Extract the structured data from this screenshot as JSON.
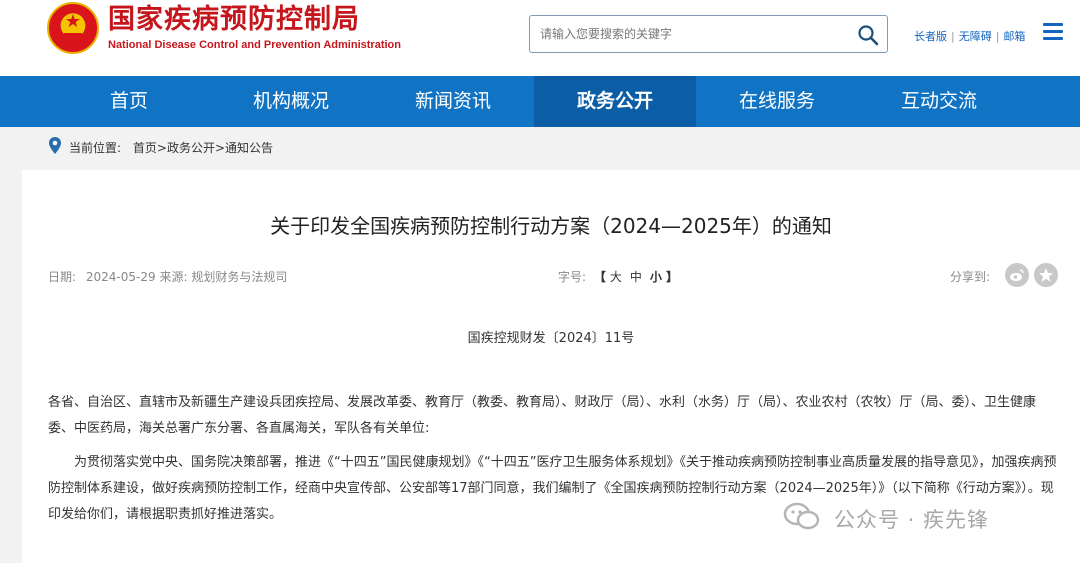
{
  "header": {
    "logo_cn": "国家疾病预防控制局",
    "logo_en": "National Disease Control and Prevention Administration",
    "search_placeholder": "请输入您要搜索的关键字",
    "links": [
      "长者版",
      "无障碍",
      "邮箱"
    ]
  },
  "nav": {
    "items": [
      {
        "label": "首页"
      },
      {
        "label": "机构概况"
      },
      {
        "label": "新闻资讯"
      },
      {
        "label": "政务公开"
      },
      {
        "label": "在线服务"
      },
      {
        "label": "互动交流"
      }
    ],
    "active": "政务公开"
  },
  "breadcrumb": {
    "prefix": "当前位置:",
    "items": [
      "首页",
      "政务公开",
      "通知公告"
    ],
    "separator": ">"
  },
  "article": {
    "title": "关于印发全国疾病预防控制行动方案（2024—2025年）的通知",
    "meta_date_label": "日期:",
    "meta_date": "2024-05-29",
    "meta_source_label": "来源:",
    "meta_source": "规划财务与法规司",
    "font_label": "字号:",
    "font_sizes": [
      "大",
      "中",
      "小"
    ],
    "share_label": "分享到:",
    "doc_number": "国疾控规财发〔2024〕11号",
    "para1": "各省、自治区、直辖市及新疆生产建设兵团疾控局、发展改革委、教育厅（教委、教育局）、财政厅（局）、水利（水务）厅（局）、农业农村（农牧）厅（局、委）、卫生健康委、中医药局，海关总署广东分署、各直属海关，军队各有关单位:",
    "para2": "为贯彻落实党中央、国务院决策部署，推进《“十四五”国民健康规划》《“十四五”医疗卫生服务体系规划》《关于推动疾病预防控制事业高质量发展的指导意见》，加强疾病预防控制体系建设，做好疾病预防控制工作，经商中央宣传部、公安部等17部门同意，我们编制了《全国疾病预防控制行动方案（2024—2025年）》（以下简称《行动方案》）。现印发给你们，请根据职责抓好推进落实。"
  },
  "watermark": "公众号 · 疾先锋",
  "colors": {
    "brand_red": "#c4161c",
    "nav_blue": "#1173c4",
    "nav_active": "#0b5da6",
    "link_blue": "#1565c0"
  }
}
